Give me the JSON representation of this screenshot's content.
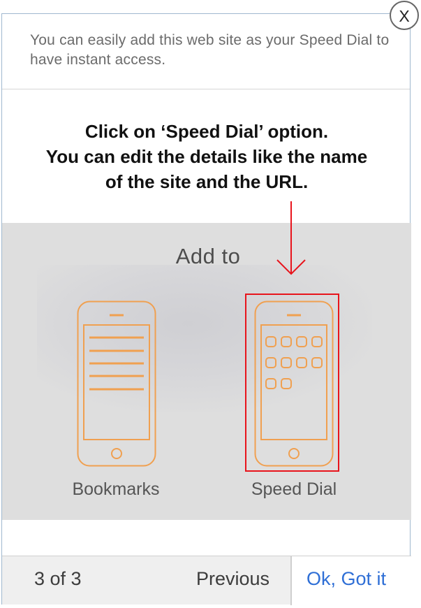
{
  "dialog": {
    "intro_text": "You can easily add this web site as your Speed Dial to have instant access.",
    "instruction_lines": [
      "Click on ‘Speed Dial’ option.",
      "You can edit the details like the name",
      "of the site and the URL."
    ],
    "close_label": "X"
  },
  "illustration": {
    "title": "Add to",
    "options": [
      {
        "label": "Bookmarks",
        "icon": "phone-bookmarks-icon"
      },
      {
        "label": "Speed Dial",
        "icon": "phone-speed-dial-icon",
        "highlighted": true
      }
    ],
    "accent_color": "#f0a050",
    "highlight_color": "#e8141c"
  },
  "footer": {
    "page_indicator": "3 of 3",
    "previous_label": "Previous",
    "ok_label": "Ok, Got it",
    "ok_color": "#2f6fd6"
  }
}
